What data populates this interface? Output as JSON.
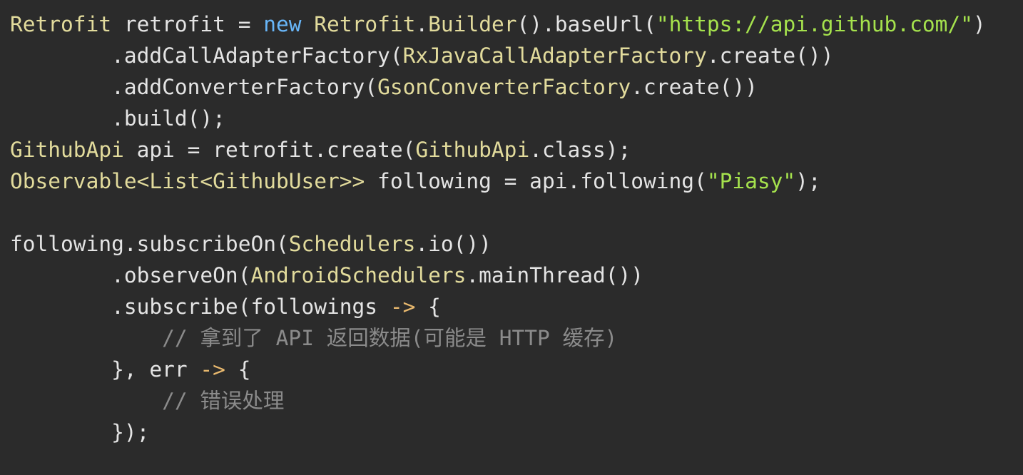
{
  "editor": {
    "lines": [
      [
        {
          "t": "Retrofit",
          "c": "type"
        },
        {
          "t": " retrofit = ",
          "c": "plain"
        },
        {
          "t": "new",
          "c": "kw"
        },
        {
          "t": " ",
          "c": "plain"
        },
        {
          "t": "Retrofit",
          "c": "type"
        },
        {
          "t": ".",
          "c": "plain"
        },
        {
          "t": "Builder",
          "c": "type"
        },
        {
          "t": "().baseUrl(",
          "c": "plain"
        },
        {
          "t": "\"https://api.github.com/\"",
          "c": "str"
        },
        {
          "t": ")",
          "c": "plain"
        }
      ],
      [
        {
          "t": "        .addCallAdapterFactory(",
          "c": "plain"
        },
        {
          "t": "RxJavaCallAdapterFactory",
          "c": "type"
        },
        {
          "t": ".create())",
          "c": "plain"
        }
      ],
      [
        {
          "t": "        .addConverterFactory(",
          "c": "plain"
        },
        {
          "t": "GsonConverterFactory",
          "c": "type"
        },
        {
          "t": ".create())",
          "c": "plain"
        }
      ],
      [
        {
          "t": "        .build();",
          "c": "plain"
        }
      ],
      [
        {
          "t": "GithubApi",
          "c": "type"
        },
        {
          "t": " api = retrofit.create(",
          "c": "plain"
        },
        {
          "t": "GithubApi",
          "c": "type"
        },
        {
          "t": ".class);",
          "c": "plain"
        }
      ],
      [
        {
          "t": "Observable<List<GithubUser>>",
          "c": "type"
        },
        {
          "t": " following = api.following(",
          "c": "plain"
        },
        {
          "t": "\"Piasy\"",
          "c": "str"
        },
        {
          "t": ");",
          "c": "plain"
        }
      ],
      [],
      [
        {
          "t": "following.subscribeOn(",
          "c": "plain"
        },
        {
          "t": "Schedulers",
          "c": "type"
        },
        {
          "t": ".io())",
          "c": "plain"
        }
      ],
      [
        {
          "t": "        .observeOn(",
          "c": "plain"
        },
        {
          "t": "AndroidSchedulers",
          "c": "type"
        },
        {
          "t": ".mainThread())",
          "c": "plain"
        }
      ],
      [
        {
          "t": "        .subscribe(followings ",
          "c": "plain"
        },
        {
          "t": "->",
          "c": "arrow"
        },
        {
          "t": " {",
          "c": "plain"
        }
      ],
      [
        {
          "t": "            // 拿到了 API 返回数据(可能是 HTTP 缓存)",
          "c": "comment"
        }
      ],
      [
        {
          "t": "        }, err ",
          "c": "plain"
        },
        {
          "t": "->",
          "c": "arrow"
        },
        {
          "t": " {",
          "c": "plain"
        }
      ],
      [
        {
          "t": "            // 错误处理",
          "c": "comment"
        }
      ],
      [
        {
          "t": "        });",
          "c": "plain"
        }
      ]
    ]
  }
}
